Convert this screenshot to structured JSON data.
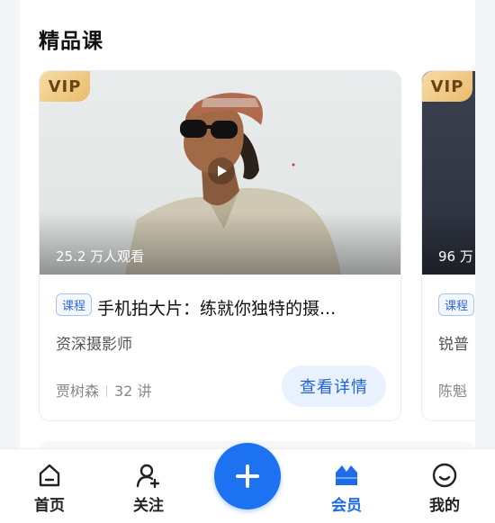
{
  "section": {
    "title": "精品课"
  },
  "cards": [
    {
      "vip": "VIP",
      "views": "25.2 万人观看",
      "tag": "课程",
      "title": "手机拍大片：练就你独特的摄...",
      "subtitle": "资深摄影师",
      "author": "贾树森",
      "lessons": "32 讲",
      "button": "查看详情"
    },
    {
      "vip": "VIP",
      "views": "96 万",
      "tag": "课程",
      "subtitle": "锐普",
      "author": "陈魁"
    }
  ],
  "tabbar": {
    "items": [
      {
        "label": "首页",
        "icon": "home-icon"
      },
      {
        "label": "关注",
        "icon": "add-user-icon"
      },
      {
        "label": "会员",
        "icon": "vip-crown-icon",
        "active": true
      },
      {
        "label": "我的",
        "icon": "profile-smile-icon"
      }
    ],
    "fab_icon": "plus-icon"
  },
  "colors": {
    "accent": "#1c72f0",
    "vip_gold": "#e9bb6c",
    "tag_blue": "#2f6ad6"
  }
}
